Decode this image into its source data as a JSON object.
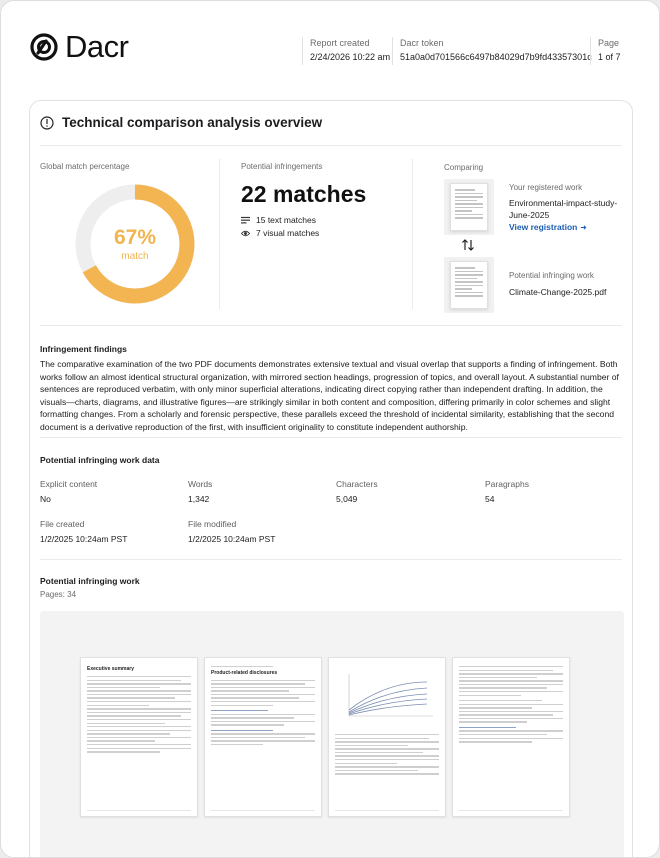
{
  "brand": {
    "name": "Dacr"
  },
  "header": {
    "report_created_label": "Report created",
    "report_created_value": "2/24/2026 10:22 am",
    "token_label": "Dacr token",
    "token_value": "51a0a0d701566c6497b84029d7b9fd43357301c",
    "page_label": "Page",
    "page_value": "1 of 7"
  },
  "card": {
    "title": "Technical comparison analysis overview",
    "global_match_label": "Global match percentage",
    "match_percent": 67,
    "match_percent_text": "67%",
    "match_word": "match",
    "colors": {
      "match_arc": "#f3b552",
      "remaining_arc": "#eeeeee"
    },
    "infringements_label": "Potential infringements",
    "matches_text": "22 matches",
    "text_matches": "15 text matches",
    "visual_matches": "7 visual matches",
    "comparing_label": "Comparing",
    "registered_label": "Your registered work",
    "registered_name": "Environmental-impact-study-June-2025",
    "view_registration": "View registration",
    "infringing_label": "Potential infringing work",
    "infringing_name": "Climate-Change-2025.pdf"
  },
  "findings": {
    "title": "Infringement findings",
    "body": "The comparative examination of the two PDF documents demonstrates extensive textual and visual overlap that supports a finding of infringement. Both works follow an almost identical structural organization, with mirrored section headings, progression of topics, and overall layout. A substantial number of sentences are reproduced verbatim, with only minor superficial alterations, indicating direct copying rather than independent drafting. In addition, the visuals—charts, diagrams, and illustrative figures—are strikingly similar in both content and composition, differing primarily in color schemes and slight formatting changes. From a scholarly and forensic perspective, these parallels exceed the threshold of incidental similarity, establishing that the second document is a derivative reproduction of the first, with insufficient originality to constitute independent authorship."
  },
  "work_data": {
    "title": "Potential infringing work data",
    "explicit_label": "Explicit content",
    "explicit_value": "No",
    "words_label": "Words",
    "words_value": "1,342",
    "characters_label": "Characters",
    "characters_value": "5,049",
    "paragraphs_label": "Paragraphs",
    "paragraphs_value": "54",
    "created_label": "File created",
    "created_value": "1/2/2025 10:24am PST",
    "modified_label": "File modified",
    "modified_value": "1/2/2025 10:24am PST"
  },
  "preview": {
    "title": "Potential infringing work",
    "pages": "Pages: 34",
    "page1_heading": "Executive summary",
    "page2_heading": "Product-related disclosures"
  }
}
